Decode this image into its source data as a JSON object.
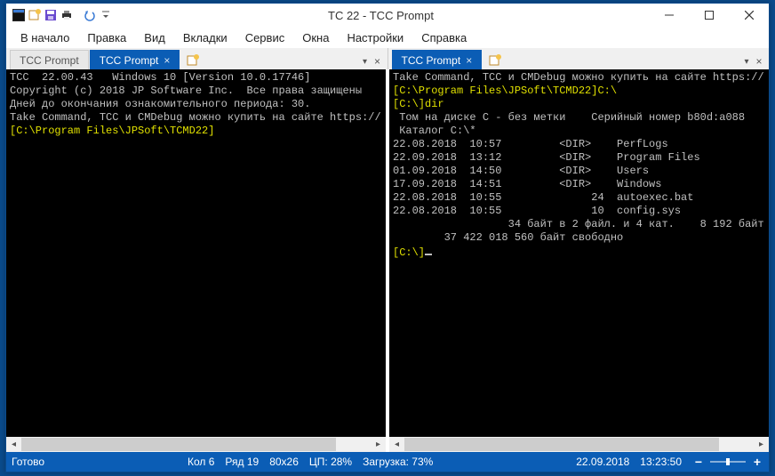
{
  "titlebar": {
    "title": "TC 22 - TCC Prompt"
  },
  "menu": {
    "items": [
      "В начало",
      "Правка",
      "Вид",
      "Вкладки",
      "Сервис",
      "Окна",
      "Настройки",
      "Справка"
    ]
  },
  "panes": {
    "left": {
      "tabs": [
        {
          "label": "TCC Prompt",
          "active": false
        },
        {
          "label": "TCC Prompt",
          "active": true
        }
      ],
      "terminal": {
        "lines": [
          {
            "cls": "gray",
            "text": ""
          },
          {
            "cls": "gray",
            "text": "TCC  22.00.43   Windows 10 [Version 10.0.17746]"
          },
          {
            "cls": "gray",
            "text": "Copyright (c) 2018 JP Software Inc.  Все права защищены"
          },
          {
            "cls": "gray",
            "text": "Дней до окончания ознакомительного периода: 30."
          },
          {
            "cls": "gray",
            "text": "Take Command, TCC и CMDebug можно купить на сайте https://"
          },
          {
            "cls": "gray",
            "text": ""
          },
          {
            "cls": "yellow",
            "text": "[C:\\Program Files\\JPSoft\\TCMD22]"
          }
        ]
      }
    },
    "right": {
      "tabs": [
        {
          "label": "TCC Prompt",
          "active": true
        }
      ],
      "terminal": {
        "lines": [
          {
            "cls": "gray",
            "text": "Take Command, TCC и CMDebug можно купить на сайте https://"
          },
          {
            "cls": "gray",
            "text": ""
          },
          {
            "cls": "yellow",
            "text": "[C:\\Program Files\\JPSoft\\TCMD22]C:\\"
          },
          {
            "cls": "gray",
            "text": ""
          },
          {
            "cls": "yellow",
            "text": "[C:\\]dir"
          },
          {
            "cls": "gray",
            "text": ""
          },
          {
            "cls": "gray",
            "text": " Том на диске C - без метки    Серийный номер b80d:a088"
          },
          {
            "cls": "gray",
            "text": " Каталог C:\\*"
          },
          {
            "cls": "gray",
            "text": ""
          },
          {
            "cls": "gray",
            "text": "22.08.2018  10:57         <DIR>    PerfLogs"
          },
          {
            "cls": "gray",
            "text": "22.09.2018  13:12         <DIR>    Program Files"
          },
          {
            "cls": "gray",
            "text": "01.09.2018  14:50         <DIR>    Users"
          },
          {
            "cls": "gray",
            "text": "17.09.2018  14:51         <DIR>    Windows"
          },
          {
            "cls": "gray",
            "text": "22.08.2018  10:55              24  autoexec.bat"
          },
          {
            "cls": "gray",
            "text": "22.08.2018  10:55              10  config.sys"
          },
          {
            "cls": "gray",
            "text": "                  34 байт в 2 файл. и 4 кат.    8 192 байт"
          },
          {
            "cls": "gray",
            "text": "        37 422 018 560 байт свободно"
          },
          {
            "cls": "gray",
            "text": ""
          },
          {
            "cls": "yellow",
            "text": "[C:\\]",
            "cursor": true
          }
        ]
      }
    }
  },
  "statusbar": {
    "ready": "Готово",
    "col": "Кол 6",
    "row": "Ряд 19",
    "size": "80x26",
    "cpu": "ЦП: 28%",
    "load": "Загрузка: 73%",
    "date": "22.09.2018",
    "time": "13:23:50"
  }
}
